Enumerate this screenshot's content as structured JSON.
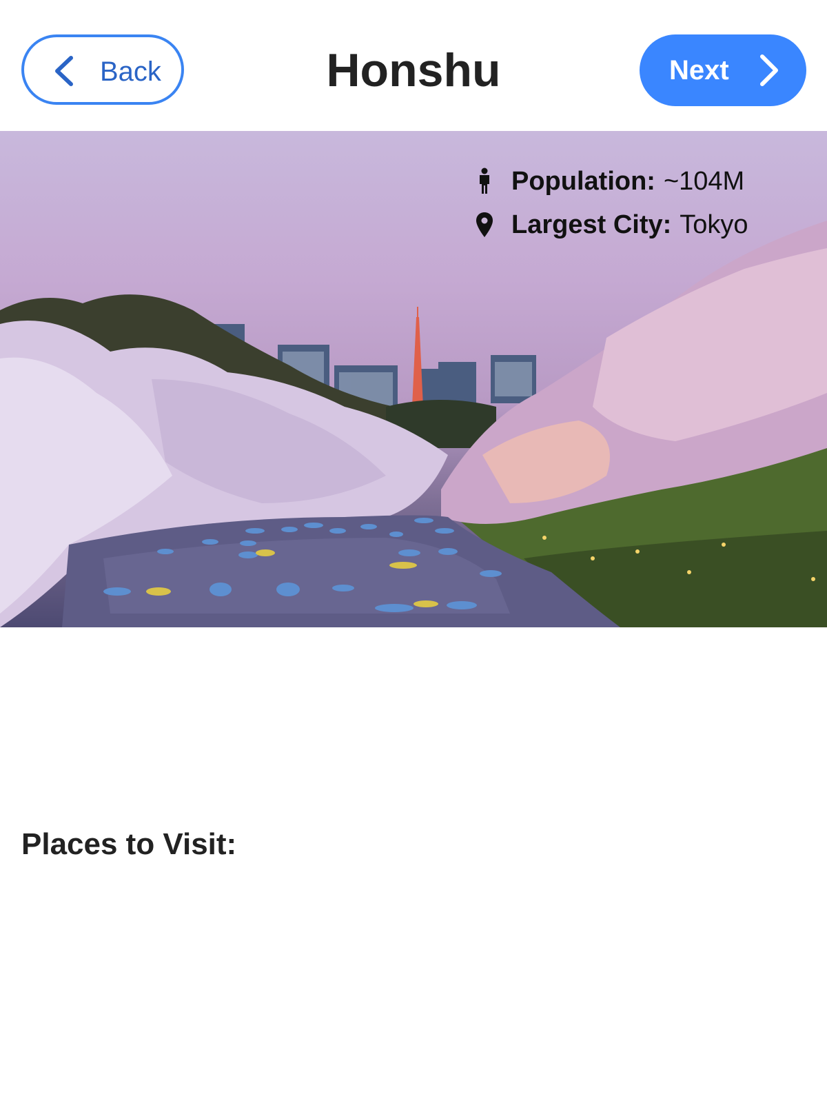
{
  "header": {
    "back_label": "Back",
    "title": "Honshu",
    "next_label": "Next"
  },
  "info": {
    "population_label": "Population:",
    "population_value": "~104M",
    "city_label": "Largest City:",
    "city_value": "Tokyo"
  },
  "icons": {
    "back": "chevron-left-icon",
    "next": "chevron-right-icon",
    "population": "person-icon",
    "city": "map-pin-icon"
  },
  "sections": {
    "places_heading": "Places to Visit:"
  },
  "colors": {
    "accent": "#3a86ff",
    "back_border": "#3a84f2",
    "back_text": "#2a64c6"
  }
}
